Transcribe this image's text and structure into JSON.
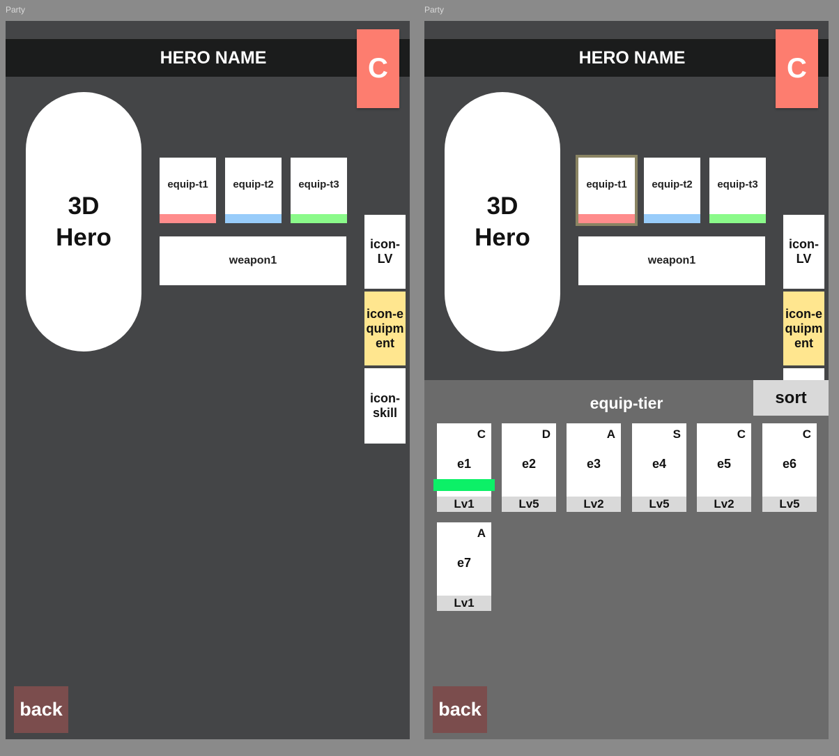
{
  "frame_label": "Party",
  "header": {
    "title": "HERO NAME",
    "close_label": "C"
  },
  "hero": {
    "line1": "3D",
    "line2": "Hero"
  },
  "equip_slots": [
    {
      "label": "equip-t1",
      "color": "#ff8c8c"
    },
    {
      "label": "equip-t2",
      "color": "#98ccfa"
    },
    {
      "label": "equip-t3",
      "color": "#8bfa8a"
    }
  ],
  "weapon": {
    "label": "weapon1"
  },
  "side_tabs": [
    {
      "label": "icon-LV"
    },
    {
      "label": "icon-equipment"
    },
    {
      "label": "icon-skill"
    }
  ],
  "back_label": "back",
  "panel": {
    "title": "equip-tier",
    "sort_label": "sort",
    "items": [
      {
        "name": "e1",
        "grade": "C",
        "level": "Lv1"
      },
      {
        "name": "e2",
        "grade": "D",
        "level": "Lv5"
      },
      {
        "name": "e3",
        "grade": "A",
        "level": "Lv2"
      },
      {
        "name": "e4",
        "grade": "S",
        "level": "Lv5"
      },
      {
        "name": "e5",
        "grade": "C",
        "level": "Lv2"
      },
      {
        "name": "e6",
        "grade": "C",
        "level": "Lv5"
      },
      {
        "name": "e7",
        "grade": "A",
        "level": "Lv1"
      }
    ]
  },
  "colors": {
    "accent_close": "#fd7d6f",
    "back_button": "#7b4d4d",
    "active_tab": "#ffe68f",
    "item_highlight": "#0cf067"
  }
}
